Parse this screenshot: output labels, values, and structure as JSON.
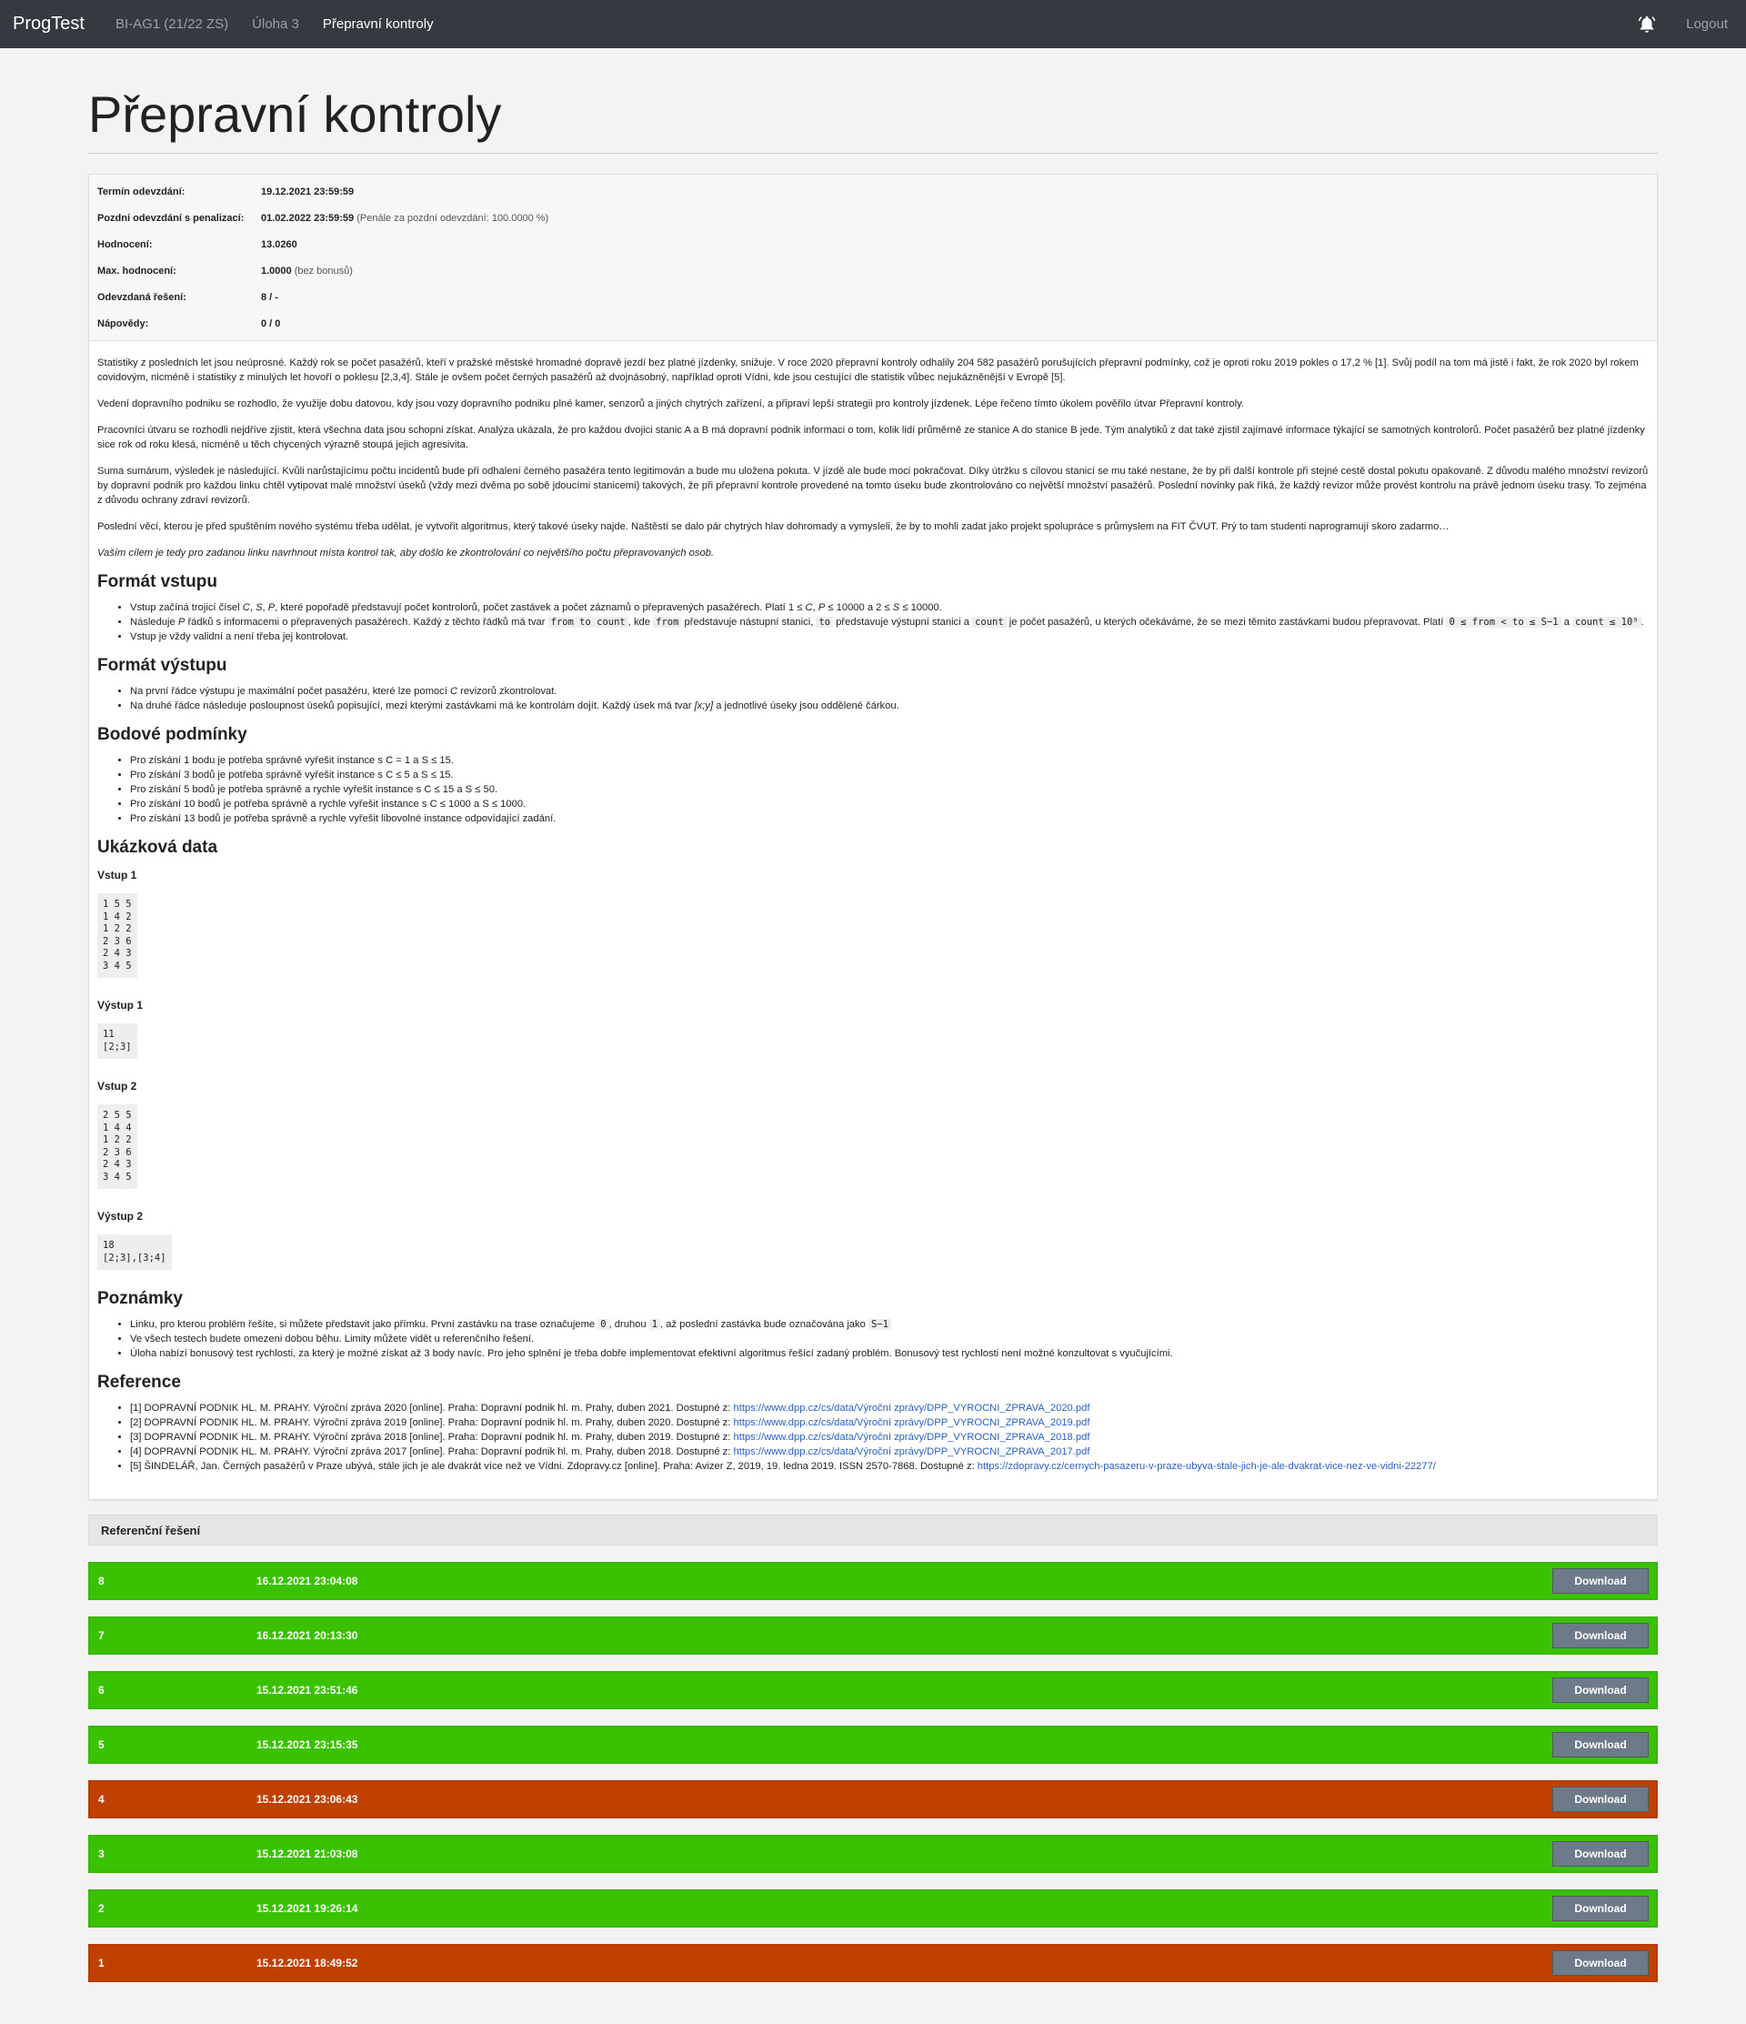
{
  "nav": {
    "brand": "ProgTest",
    "course": "BI-AG1 (21/22 ZS)",
    "task": "Úloha 3",
    "current": "Přepravní kontroly",
    "logout": "Logout"
  },
  "title": "Přepravní kontroly",
  "info": [
    {
      "k": "Termín odevzdání:",
      "v": "19.12.2021 23:59:59",
      "note": ""
    },
    {
      "k": "Pozdní odevzdání s penalizací:",
      "v": "01.02.2022 23:59:59",
      "note": "(Penále za pozdní odevzdání: 100.0000 %)"
    },
    {
      "k": "Hodnocení:",
      "v": "13.0260",
      "note": ""
    },
    {
      "k": "Max. hodnocení:",
      "v": "1.0000",
      "note": "(bez bonusů)"
    },
    {
      "k": "Odevzdaná řešení:",
      "v": "8 / -",
      "note": ""
    },
    {
      "k": "Nápovědy:",
      "v": "0 / 0",
      "note": ""
    }
  ],
  "intro": [
    "Statistiky z posledních let jsou neúprosné. Každý rok se počet pasažérů, kteří v pražské městské hromadné dopravě jezdí bez platné jízdenky, snižuje. V roce 2020 přepravní kontroly odhalily 204 582 pasažérů porušujících přepravní podmínky, což je oproti roku 2019 pokles o 17,2 % [1]. Svůj podíl na tom má jistě i fakt, že rok 2020 byl rokem covidovým, nicméně i statistiky z minulých let hovoří o poklesu [2,3,4]. Stále je ovšem počet černých pasažérů až dvojnásobný, například oproti Vídni, kde jsou cestující dle statistik vůbec nejukázněnější v Evropě [5].",
    "Vedení dopravního podniku se rozhodlo, že využije dobu datovou, kdy jsou vozy dopravního podniku plné kamer, senzorů a jiných chytrých zařízení, a připraví lepší strategii pro kontroly jízdenek. Lépe řečeno tímto úkolem pověřilo útvar Přepravní kontroly.",
    "Pracovníci útvaru se rozhodli nejdříve zjistit, která všechna data jsou schopni získat. Analýza ukázala, že pro každou dvojici stanic A a B má dopravní podnik informaci o tom, kolik lidí průměrně ze stanice A do stanice B jede. Tým analytiků z dat také zjistil zajímavé informace týkající se samotných kontrolorů. Počet pasažérů bez platné jízdenky sice rok od roku klesá, nicméně u těch chycených výrazně stoupá jejich agresivita.",
    "Suma sumárum, výsledek je následující. Kvůli narůstajícímu počtu incidentů bude při odhalení černého pasažéra tento legitimován a bude mu uložena pokuta. V jízdě ale bude moci pokračovat. Díky útržku s cílovou stanicí se mu také nestane, že by při další kontrole při stejné cestě dostal pokutu opakovaně. Z důvodu malého množství revizorů by dopravní podnik pro každou linku chtěl vytipovat malé množství úseků (vždy mezi dvěma po sobě jdoucími stanicemi) takových, že při přepravní kontrole provedené na tomto úseku bude zkontrolováno co největší množství pasažérů. Poslední novinky pak říká, že každý revizor může provést kontrolu na právě jednom úseku trasy. To zejména z důvodu ochrany zdraví revizorů.",
    "Poslední věcí, kterou je před spuštěním nového systému třeba udělat, je vytvořit algoritmus, který takové úseky najde. Naštěstí se dalo pár chytrých hlav dohromady a vymysleli, že by to mohli zadat jako projekt spolupráce s průmyslem na FIT ČVUT. Prý to tam studenti naprogramují skoro zadarmo…"
  ],
  "goal": "Vaším cílem je tedy pro zadanou linku navrhnout místa kontrol tak, aby došlo ke zkontrolování co největšího počtu přepravovaných osob.",
  "input_format": {
    "heading": "Formát vstupu",
    "items": [
      "Vstup začíná trojicí čísel C, S, P, které popořadě představují počet kontrolorů, počet zastávek a počet záznamů o přepravených pasažérech. Platí 1 ≤ C, P ≤ 10000 a 2 ≤ S ≤ 10000.",
      "Následuje P řádků s informacemi o přepravených pasažérech. Každý z těchto řádků má tvar from to count, kde from představuje nástupní stanici, to představuje výstupní stanici a count je počet pasažérů, u kterých očekáváme, že se mezi těmito zastávkami budou přepravovat. Platí 0 ≤ from < to ≤ S−1 a count ≤ 10⁹.",
      "Vstup je vždy validní a není třeba jej kontrolovat."
    ]
  },
  "output_format": {
    "heading": "Formát výstupu",
    "items": [
      "Na první řádce výstupu je maximální počet pasažéru, které lze pomocí C revizorů zkontrolovat.",
      "Na druhé řádce následuje posloupnost úseků popisující, mezi kterými zastávkami má ke kontrolám dojít. Každý úsek má tvar [x;y] a jednotlivé úseky jsou oddělené čárkou."
    ]
  },
  "points": {
    "heading": "Bodové podmínky",
    "items": [
      "Pro získání 1 bodu je potřeba správně vyřešit instance s C = 1 a S ≤ 15.",
      "Pro získání 3 bodů je potřeba správně vyřešit instance s C ≤ 5 a S ≤ 15.",
      "Pro získání 5 bodů je potřeba správně a rychle vyřešit instance s C ≤ 15 a S ≤ 50.",
      "Pro získání 10 bodů je potřeba správně a rychle vyřešit instance s C ≤ 1000 a S ≤ 1000.",
      "Pro získání 13 bodů je potřeba správně a rychle vyřešit libovolné instance odpovídající zadání."
    ]
  },
  "samples": {
    "heading": "Ukázková data",
    "blocks": [
      {
        "label": "Vstup 1",
        "text": "1 5 5\n1 4 2\n1 2 2\n2 3 6\n2 4 3\n3 4 5"
      },
      {
        "label": "Výstup 1",
        "text": "11\n[2;3]"
      },
      {
        "label": "Vstup 2",
        "text": "2 5 5\n1 4 4\n1 2 2\n2 3 6\n2 4 3\n3 4 5"
      },
      {
        "label": "Výstup 2",
        "text": "18\n[2;3],[3;4]"
      }
    ]
  },
  "notes": {
    "heading": "Poznámky",
    "items": [
      "Linku, pro kterou problém řešíte, si můžete představit jako přímku. První zastávku na trase označujeme 0, druhou 1, až poslední zastávka bude označována jako S−1",
      "Ve všech testech budete omezeni dobou běhu. Limity můžete vidět u referenčního řešení.",
      "Úloha nabízí bonusový test rychlosti, za který je možné získat až 3 body navíc. Pro jeho splnění je třeba dobře implementovat efektivní algoritmus řešící zadaný problém. Bonusový test rychlosti není možné konzultovat s vyučujícími."
    ]
  },
  "references": {
    "heading": "Reference",
    "items": [
      {
        "text": "[1] DOPRAVNÍ PODNIK HL. M. PRAHY. Výroční zpráva 2020 [online]. Praha: Dopravní podnik hl. m. Prahy, duben 2021. Dostupné z: ",
        "url": "https://www.dpp.cz/cs/data/Výroční zprávy/DPP_VYROCNI_ZPRAVA_2020.pdf"
      },
      {
        "text": "[2] DOPRAVNÍ PODNIK HL. M. PRAHY. Výroční zpráva 2019 [online]. Praha: Dopravní podnik hl. m. Prahy, duben 2020. Dostupné z: ",
        "url": "https://www.dpp.cz/cs/data/Výroční zprávy/DPP_VYROCNI_ZPRAVA_2019.pdf"
      },
      {
        "text": "[3] DOPRAVNÍ PODNIK HL. M. PRAHY. Výroční zpráva 2018 [online]. Praha: Dopravní podnik hl. m. Prahy, duben 2019. Dostupné z: ",
        "url": "https://www.dpp.cz/cs/data/Výroční zprávy/DPP_VYROCNI_ZPRAVA_2018.pdf"
      },
      {
        "text": "[4] DOPRAVNÍ PODNIK HL. M. PRAHY. Výroční zpráva 2017 [online]. Praha: Dopravní podnik hl. m. Prahy, duben 2018. Dostupné z: ",
        "url": "https://www.dpp.cz/cs/data/Výroční zprávy/DPP_VYROCNI_ZPRAVA_2017.pdf"
      },
      {
        "text": "[5] ŠINDELÁŘ, Jan. Černých pasažérů v Praze ubývá, stále jich je ale dvakrát více než ve Vídni. Zdopravy.cz [online]. Praha: Avizer Z, 2019, 19. ledna 2019. ISSN 2570-7868. Dostupné z: ",
        "url": "https://zdopravy.cz/cernych-pasazeru-v-praze-ubyva-stale-jich-je-ale-dvakrat-vice-nez-ve-vidni-22277/"
      }
    ]
  },
  "reference_solution_label": "Referenční řešení",
  "download_label": "Download",
  "submissions": [
    {
      "num": "8",
      "date": "16.12.2021 23:04:08",
      "status": "ok"
    },
    {
      "num": "7",
      "date": "16.12.2021 20:13:30",
      "status": "ok"
    },
    {
      "num": "6",
      "date": "15.12.2021 23:51:46",
      "status": "ok"
    },
    {
      "num": "5",
      "date": "15.12.2021 23:15:35",
      "status": "ok"
    },
    {
      "num": "4",
      "date": "15.12.2021 23:06:43",
      "status": "fail"
    },
    {
      "num": "3",
      "date": "15.12.2021 21:03:08",
      "status": "ok"
    },
    {
      "num": "2",
      "date": "15.12.2021 19:26:14",
      "status": "ok"
    },
    {
      "num": "1",
      "date": "15.12.2021 18:49:52",
      "status": "fail"
    }
  ],
  "colors": {
    "ok": "#3ac200",
    "fail": "#c04000",
    "nav": "#343a40"
  }
}
